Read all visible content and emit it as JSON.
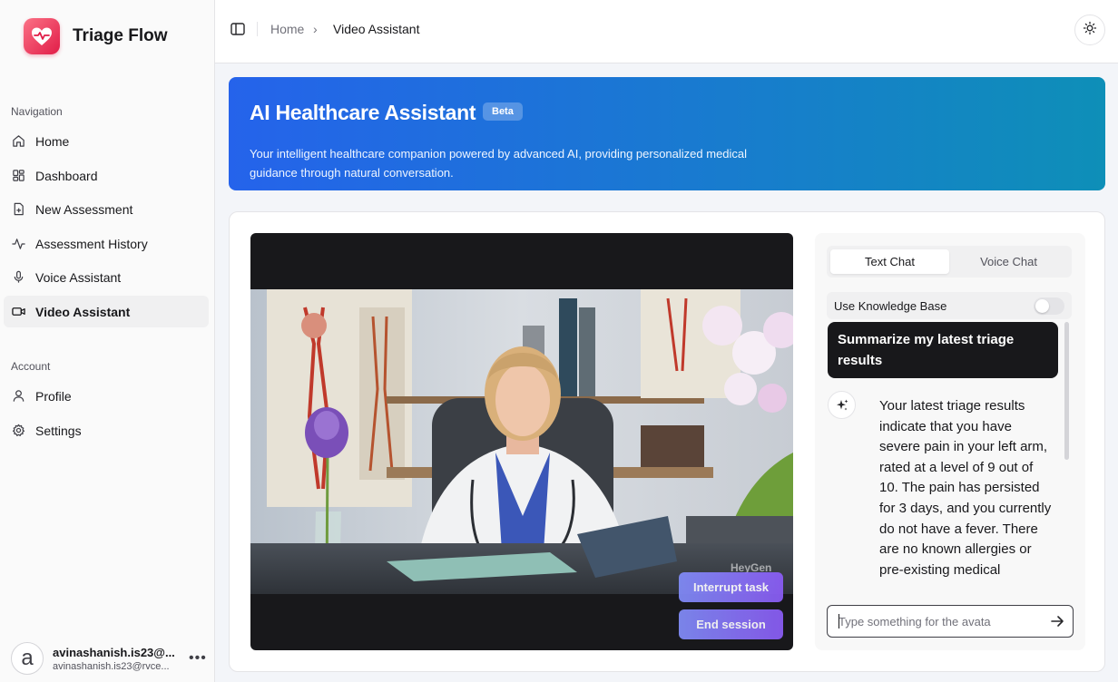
{
  "app": {
    "name": "Triage Flow"
  },
  "sidebar": {
    "nav_label": "Navigation",
    "nav_items": [
      {
        "label": "Home",
        "icon": "home-icon"
      },
      {
        "label": "Dashboard",
        "icon": "dashboard-icon"
      },
      {
        "label": "New Assessment",
        "icon": "file-plus-icon"
      },
      {
        "label": "Assessment History",
        "icon": "activity-icon"
      },
      {
        "label": "Voice Assistant",
        "icon": "microphone-icon"
      },
      {
        "label": "Video Assistant",
        "icon": "video-icon",
        "active": true
      }
    ],
    "account_label": "Account",
    "account_items": [
      {
        "label": "Profile",
        "icon": "user-icon"
      },
      {
        "label": "Settings",
        "icon": "gear-icon"
      }
    ],
    "user": {
      "avatar_letter": "a",
      "name": "avinashanish.is23@...",
      "email": "avinashanish.is23@rvce..."
    }
  },
  "header": {
    "breadcrumb": {
      "home": "Home",
      "separator": "›",
      "current": "Video Assistant"
    }
  },
  "hero": {
    "title": "AI Healthcare Assistant",
    "badge": "Beta",
    "description": "Your intelligent healthcare companion powered by advanced AI, providing personalized medical guidance through natural conversation."
  },
  "video": {
    "watermark": "HeyGen",
    "interrupt_label": "Interrupt task",
    "end_label": "End session"
  },
  "chat": {
    "tabs": [
      {
        "label": "Text Chat",
        "active": true
      },
      {
        "label": "Voice Chat",
        "active": false
      }
    ],
    "knowledge_base_label": "Use Knowledge Base",
    "knowledge_base_enabled": false,
    "messages": {
      "user": "Summarize my latest triage results",
      "assistant": "Your latest triage results indicate that you have severe pain in your left arm, rated at a level of 9 out of 10. The pain has persisted for 3 days, and you currently do not have a fever. There are no known allergies or pre-existing medical"
    },
    "input_placeholder": "Type something for the avata",
    "input_value": ""
  },
  "colors": {
    "hero_start": "#2563eb",
    "hero_end": "#0e8fb8",
    "button_start": "#818cf8",
    "button_end": "#8b5cf6",
    "brand": "#e11d48"
  }
}
